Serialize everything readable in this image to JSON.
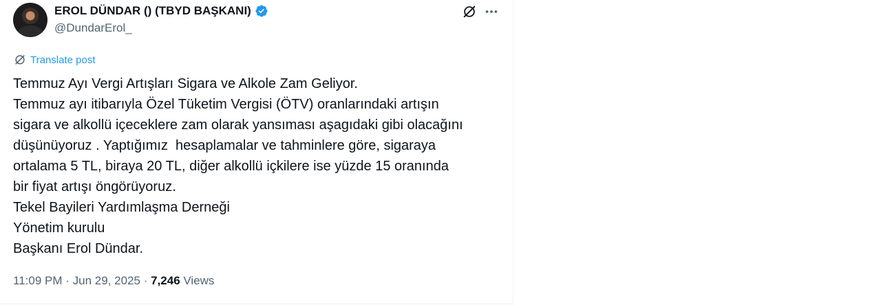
{
  "post": {
    "display_name": "EROL DÜNDAR () (TBYD BAŞKANI)",
    "handle": "@DundarErol_",
    "translate_label": "Translate post",
    "lines": [
      "Temmuz Ayı Vergi Artışları Sigara ve Alkole Zam Geliyor.",
      "Temmuz ayı itibarıyla Özel Tüketim Vergisi (ÖTV) oranlarındaki artışın",
      "sigara ve alkollü içeceklere zam olarak yansıması aşagıdaki gibi olacağını",
      "düşünüyoruz . Yaptığımız  hesaplamalar ve tahminlere göre, sigaraya",
      "ortalama 5 TL, biraya 20 TL, diğer alkollü içkilere ise yüzde 15 oranında",
      "bir fiyat artışı öngörüyoruz.",
      "Tekel Bayileri Yardımlaşma Derneği",
      "Yönetim kurulu",
      "Başkanı Erol Dündar."
    ],
    "time": "11:09 PM",
    "separator": "·",
    "date": "Jun 29, 2025",
    "views_count": "7,246",
    "views_label": "Views"
  },
  "icons": {
    "verified": "verified-badge-icon",
    "grok": "grok-icon",
    "more": "more-icon",
    "translate": "translate-icon"
  },
  "colors": {
    "accent": "#1d9bf0",
    "text": "#0f1419",
    "muted": "#536471"
  }
}
